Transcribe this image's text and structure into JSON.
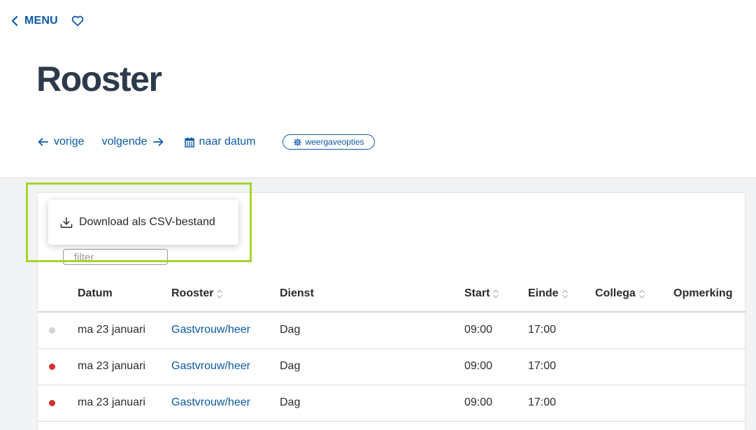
{
  "topbar": {
    "menu_label": "MENU"
  },
  "page": {
    "title": "Rooster"
  },
  "nav": {
    "prev_label": "vorige",
    "next_label": "volgende",
    "date_label": "naar datum",
    "options_label": "weergaveopties"
  },
  "popup": {
    "download_label": "Download als CSV-bestand"
  },
  "filter": {
    "placeholder": "filter"
  },
  "table": {
    "columns": [
      "Datum",
      "Rooster",
      "Dienst",
      "Start",
      "Einde",
      "Collega",
      "Opmerking"
    ],
    "rows": [
      {
        "status": "grey",
        "datum": "ma 23 januari",
        "rooster": "Gastvrouw/heer",
        "dienst": "Dag",
        "start": "09:00",
        "einde": "17:00"
      },
      {
        "status": "red",
        "datum": "ma 23 januari",
        "rooster": "Gastvrouw/heer",
        "dienst": "Dag",
        "start": "09:00",
        "einde": "17:00"
      },
      {
        "status": "red",
        "datum": "ma 23 januari",
        "rooster": "Gastvrouw/heer",
        "dienst": "Dag",
        "start": "09:00",
        "einde": "17:00"
      }
    ]
  },
  "colors": {
    "accent": "#0b5aa5",
    "title": "#2d3a4c",
    "highlight": "#a7d42c",
    "status_grey": "#d3d3d3",
    "status_red": "#d32f2f"
  }
}
